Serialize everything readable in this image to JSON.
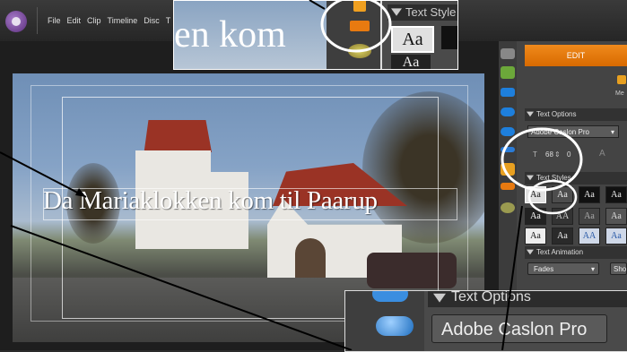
{
  "menu": [
    "File",
    "Edit",
    "Clip",
    "Timeline",
    "Disc",
    "T"
  ],
  "title_text": "Da Mariaklokken kom til Paarup",
  "zoom_top": {
    "text": "en kom",
    "styles_header": "Text Style",
    "swatch": "Aa",
    "swatch2": "Aa"
  },
  "panel": {
    "edit_tab": "EDIT",
    "text_options": "Text Options",
    "font": "Adobe Caslon Pro",
    "size_value": "68",
    "leading_value": "0",
    "text_styles": "Text Styles",
    "text_animation": "Text Animation",
    "animation_value": "Fades",
    "show_button": "Sho",
    "me_label": "Me"
  },
  "swatches": [
    "Aa",
    "Aa",
    "Aa",
    "Aa",
    "Aa",
    "AA",
    "Aa",
    "Aa",
    "Aa",
    "Aa",
    "AA",
    "Aa"
  ],
  "zoom_bottom": {
    "header": "Text Options",
    "font": "Adobe Caslon Pro"
  },
  "colors": {
    "accent": "#e87a10",
    "tool_blue": "#1e7fdc"
  }
}
